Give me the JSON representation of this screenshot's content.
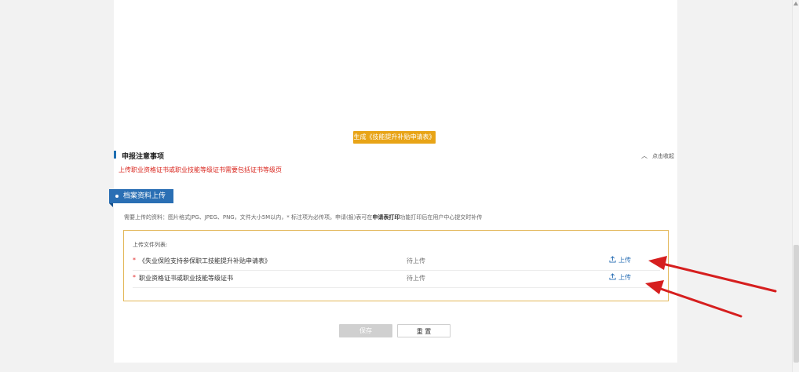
{
  "generate_button": "生成《技能提升补贴申请表》",
  "notice": {
    "title": "申报注意事项",
    "collapse_label": "点击收起",
    "warning_text": "上传职业资格证书或职业技能等级证书需要包括证书等级页"
  },
  "archive_section": {
    "tab_label": "档案资料上传",
    "hint_prefix": "需要上传的资料：图片格式JPG、JPEG、PNG，文件大小5M以内，* 标注项为必传项。申请(报)表可在",
    "hint_bold": "申请表打印",
    "hint_suffix": "功能打印后在用户中心提交时补传",
    "list_title": "上传文件列表:",
    "files": [
      {
        "required_mark": "*",
        "name": "《失业保险支持参保职工技能提升补贴申请表》",
        "status": "待上传",
        "action": "上传"
      },
      {
        "required_mark": "*",
        "name": "职业资格证书或职业技能等级证书",
        "status": "待上传",
        "action": "上传"
      }
    ]
  },
  "buttons": {
    "save": "保存",
    "reset": "重 置"
  },
  "colors": {
    "accent_blue": "#2a6fb4",
    "generate_orange": "#e8a417",
    "warning_red": "#d9241c",
    "box_border": "#e3b758",
    "arrow_red": "#d61f1f"
  }
}
